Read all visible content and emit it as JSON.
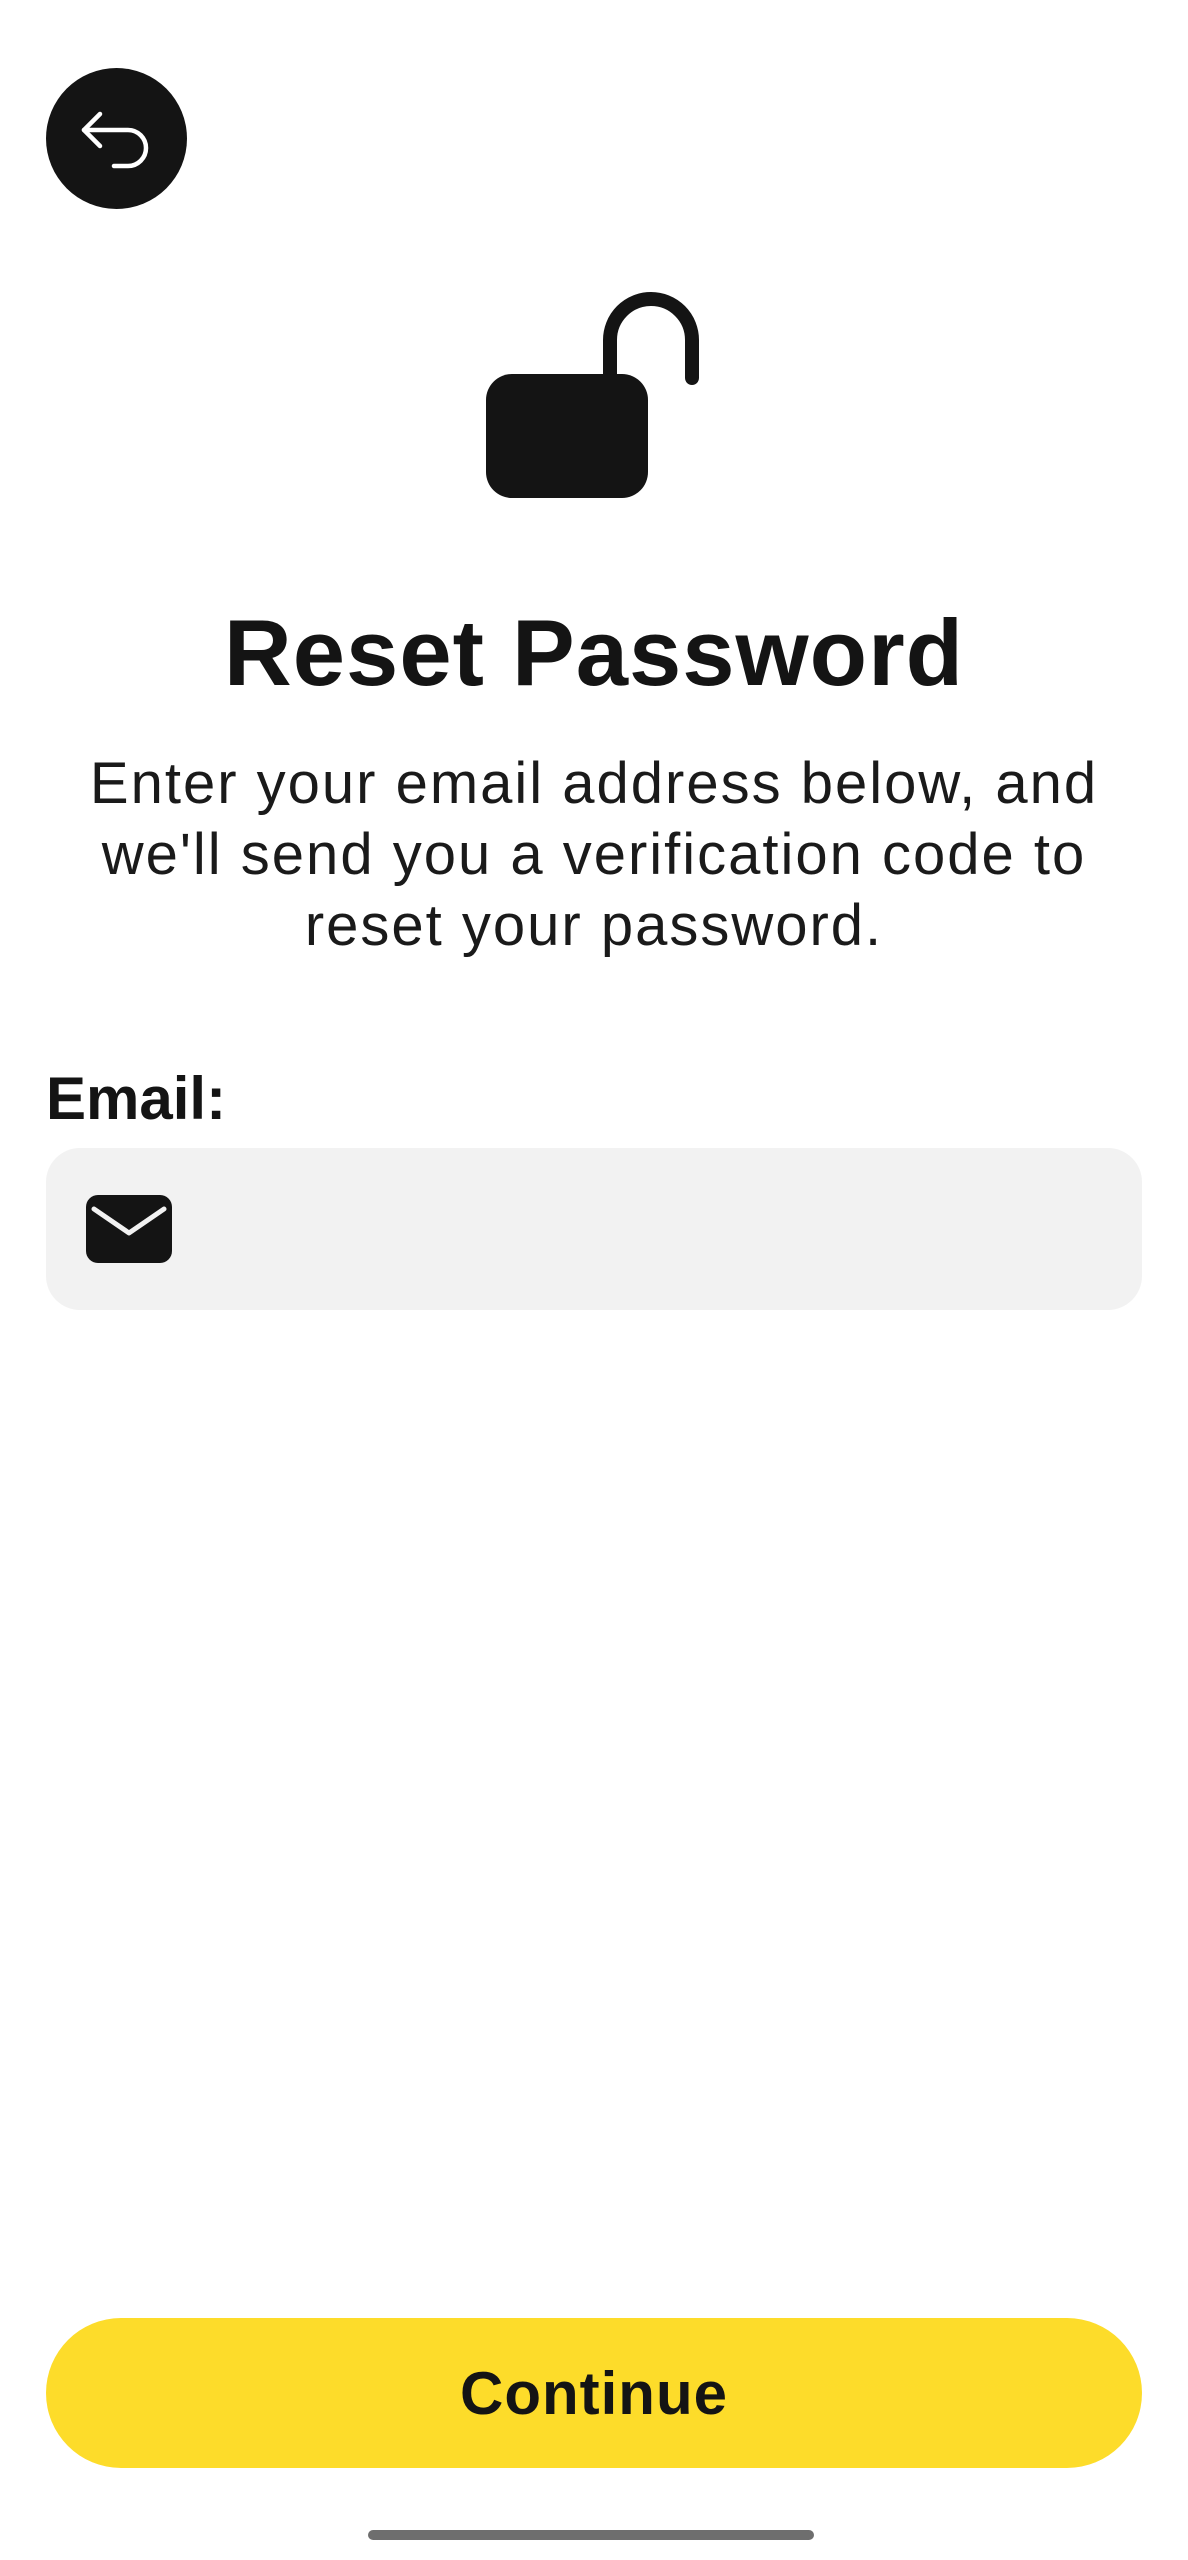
{
  "screen": {
    "title": "Reset Password",
    "description": "Enter your email address below, and we'll send you a verification code to reset your password."
  },
  "nav": {
    "back_icon": "back-arrow-icon"
  },
  "hero": {
    "icon": "unlocked-lock-icon"
  },
  "form": {
    "email_label": "Email:",
    "email_icon": "mail-icon",
    "email_value": "",
    "email_placeholder": ""
  },
  "actions": {
    "continue_label": "Continue"
  },
  "colors": {
    "accent": "#fddc2a",
    "dark": "#141414",
    "field_background": "#f2f2f2",
    "background": "#ffffff"
  }
}
